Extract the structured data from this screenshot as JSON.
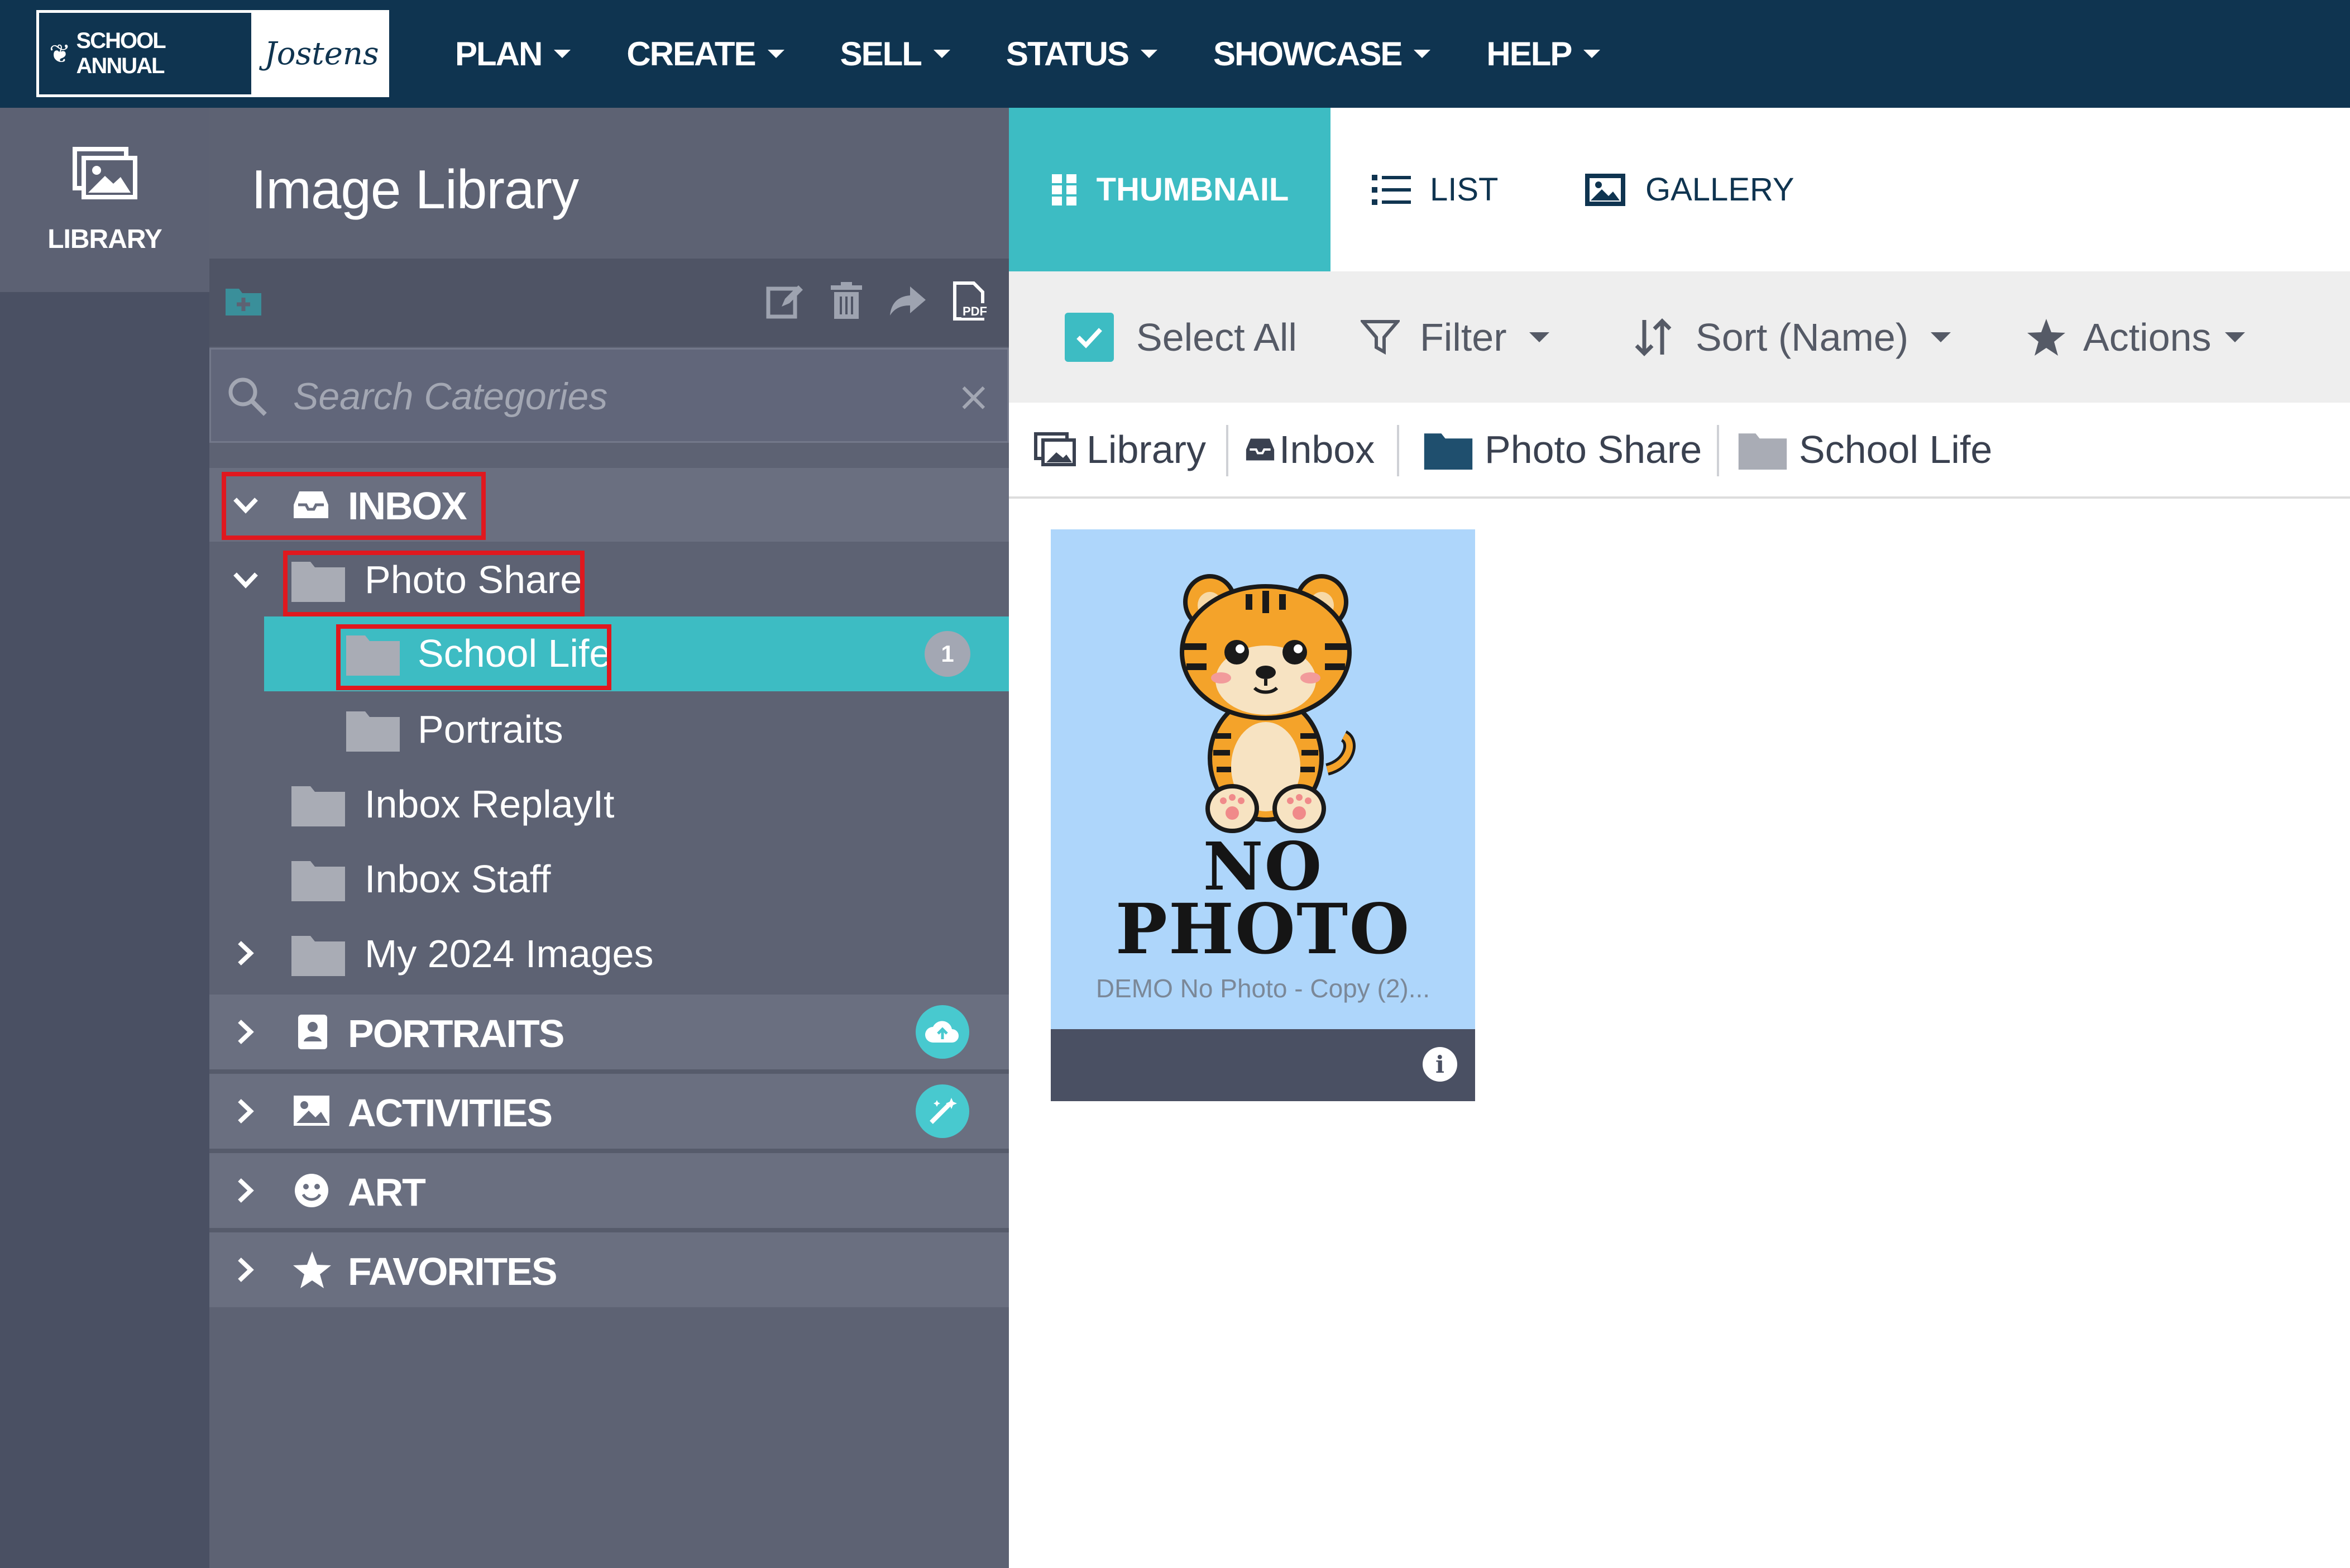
{
  "header": {
    "logo": {
      "brand": "SCHOOL ANNUAL",
      "partner": "Jostens"
    },
    "nav": [
      {
        "label": "PLAN"
      },
      {
        "label": "CREATE"
      },
      {
        "label": "SELL"
      },
      {
        "label": "STATUS"
      },
      {
        "label": "SHOWCASE"
      },
      {
        "label": "HELP"
      }
    ]
  },
  "rail": {
    "library_label": "LIBRARY"
  },
  "panel": {
    "title": "Image Library",
    "search": {
      "placeholder": "Search Categories",
      "value": ""
    },
    "tree": {
      "inbox": "INBOX",
      "photo_share": "Photo Share",
      "school_life": "School Life",
      "school_life_count": "1",
      "portraits_folder": "Portraits",
      "inbox_replayit": "Inbox ReplayIt",
      "inbox_staff": "Inbox Staff",
      "my_2024_images": "My 2024 Images",
      "portraits_section": "PORTRAITS",
      "activities_section": "ACTIVITIES",
      "art_section": "ART",
      "favorites_section": "FAVORITES"
    }
  },
  "content": {
    "view_tabs": [
      {
        "label": "THUMBNAIL",
        "active": true
      },
      {
        "label": "LIST",
        "active": false
      },
      {
        "label": "GALLERY",
        "active": false
      }
    ],
    "toolbar": {
      "select_all": "Select All",
      "filter": "Filter",
      "sort": "Sort (Name)",
      "actions": "Actions"
    },
    "breadcrumb": [
      "Library",
      "Inbox",
      "Photo Share",
      "School Life"
    ],
    "items": [
      {
        "image_text_1": "NO",
        "image_text_2": "PHOTO",
        "name": "DEMO No Photo - Copy (2)..."
      }
    ]
  },
  "colors": {
    "topbar": "#0f3450",
    "accent": "#3dbcc3",
    "panel": "#5d6273",
    "highlight": "#e0181e"
  }
}
